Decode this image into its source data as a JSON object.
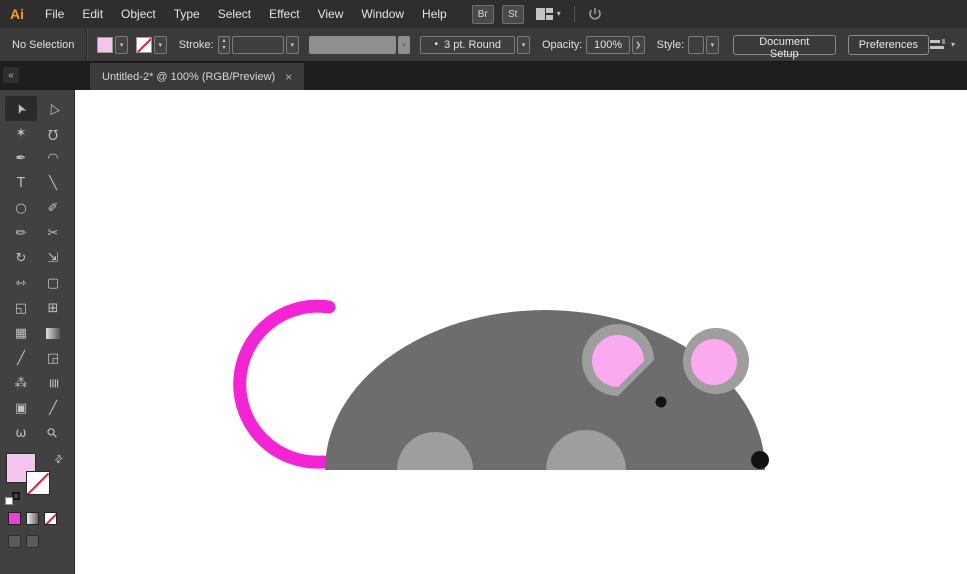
{
  "menubar": {
    "logo": "Ai",
    "menus": [
      "File",
      "Edit",
      "Object",
      "Type",
      "Select",
      "Effect",
      "View",
      "Window",
      "Help"
    ],
    "bridge_button": "Br",
    "stock_button": "St"
  },
  "controlbar": {
    "selection_status": "No Selection",
    "stroke_label": "Stroke:",
    "stroke_weight_value": "",
    "brush_value": "3 pt. Round",
    "opacity_label": "Opacity:",
    "opacity_value": "100%",
    "style_label": "Style:",
    "document_setup_button": "Document Setup",
    "preferences_button": "Preferences"
  },
  "tabstrip": {
    "tab_title": "Untitled-2* @ 100% (RGB/Preview)"
  },
  "icons": {
    "caret_down": "▾",
    "chevron_right": "❯",
    "stepper_up": "▴",
    "stepper_down": "▾",
    "collapse": "«",
    "close": "×",
    "brush_dot": "•",
    "swap": "⇄"
  },
  "toolbar": {
    "tools": [
      {
        "name": "selection-tool",
        "glyph": "➤",
        "rot": -115,
        "active": true
      },
      {
        "name": "direct-selection-tool",
        "glyph": "▷",
        "rot": -115
      },
      {
        "name": "magic-wand-tool",
        "glyph": "✶"
      },
      {
        "name": "lasso-tool",
        "glyph": "Ω",
        "rot": 180
      },
      {
        "name": "pen-tool",
        "glyph": "✒"
      },
      {
        "name": "curvature-tool",
        "glyph": "◠"
      },
      {
        "name": "type-tool",
        "glyph": "T"
      },
      {
        "name": "line-segment-tool",
        "glyph": "╲"
      },
      {
        "name": "ellipse-tool",
        "glyph": "○"
      },
      {
        "name": "paintbrush-tool",
        "glyph": "✐"
      },
      {
        "name": "pencil-tool",
        "glyph": "✏"
      },
      {
        "name": "scissors-tool",
        "glyph": "✂"
      },
      {
        "name": "rotate-tool",
        "glyph": "↻"
      },
      {
        "name": "scale-tool",
        "glyph": "⇲"
      },
      {
        "name": "width-tool",
        "glyph": "⇿"
      },
      {
        "name": "free-transform-tool",
        "glyph": "▢"
      },
      {
        "name": "shape-builder-tool",
        "glyph": "◱"
      },
      {
        "name": "perspective-grid-tool",
        "glyph": "⊞"
      },
      {
        "name": "mesh-tool",
        "glyph": "▦"
      },
      {
        "name": "gradient-tool",
        "glyph": "",
        "gradient": true
      },
      {
        "name": "eyedropper-tool",
        "glyph": "╱"
      },
      {
        "name": "blend-tool",
        "glyph": "◲"
      },
      {
        "name": "symbol-sprayer-tool",
        "glyph": "⁂"
      },
      {
        "name": "column-graph-tool",
        "glyph": "≣",
        "rot": 90
      },
      {
        "name": "artboard-tool",
        "glyph": "▣"
      },
      {
        "name": "slice-tool",
        "glyph": "╱"
      },
      {
        "name": "hand-tool",
        "glyph": "ω"
      },
      {
        "name": "zoom-tool",
        "glyph": "⚲",
        "rot": -45
      }
    ]
  },
  "colors": {
    "brand_orange": "#ff9a1e"
  },
  "swatches": {
    "fill": "#f6c2ee",
    "color_button": "#ee3fd8"
  },
  "artwork": {
    "body": "#6d6d6d",
    "feet": "#9e9e9e",
    "ear_outer": "#9e9e9e",
    "ear_inner": "#fbaaf0",
    "tail": "#f623d6",
    "eye": "#121212",
    "nose": "#121212"
  }
}
